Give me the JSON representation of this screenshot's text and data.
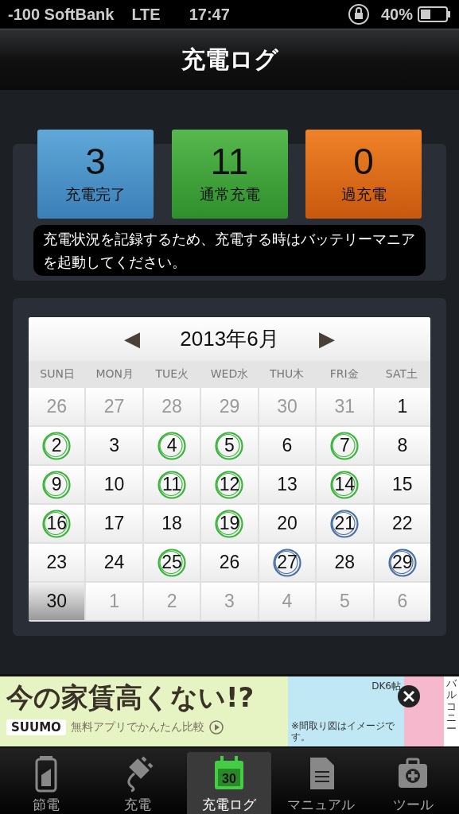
{
  "status_bar": {
    "carrier": "-100 SoftBank",
    "network": "LTE",
    "time": "17:47",
    "battery": "40%"
  },
  "header": {
    "title": "充電ログ"
  },
  "summary": [
    {
      "kind": "complete",
      "count": "3",
      "label": "充電完了"
    },
    {
      "kind": "normal",
      "count": "11",
      "label": "通常充電"
    },
    {
      "kind": "over",
      "count": "0",
      "label": "過充電"
    }
  ],
  "notice": "充電状況を記録するため、充電する時はバッテリーマニアを起動してください。",
  "calendar": {
    "prev": "◀",
    "title": "2013年6月",
    "next": "▶",
    "weekdays": [
      "SUN日",
      "MON月",
      "TUE火",
      "WED水",
      "THU木",
      "FRI金",
      "SAT土"
    ],
    "days": [
      {
        "day": "26",
        "muted": true,
        "selected": false
      },
      {
        "day": "27",
        "muted": true,
        "selected": false
      },
      {
        "day": "28",
        "muted": true,
        "selected": false
      },
      {
        "day": "29",
        "muted": true,
        "selected": false
      },
      {
        "day": "30",
        "muted": true,
        "selected": false
      },
      {
        "day": "31",
        "muted": true,
        "selected": false
      },
      {
        "day": "1",
        "muted": false,
        "selected": false
      },
      {
        "day": "2",
        "muted": false,
        "selected": false,
        "color": "#3cb43c"
      },
      {
        "day": "3",
        "muted": false,
        "selected": false
      },
      {
        "day": "4",
        "muted": false,
        "selected": false,
        "color": "#3cb43c"
      },
      {
        "day": "5",
        "muted": false,
        "selected": false,
        "color": "#3cb43c"
      },
      {
        "day": "6",
        "muted": false,
        "selected": false
      },
      {
        "day": "7",
        "muted": false,
        "selected": false,
        "color": "#3cb43c"
      },
      {
        "day": "8",
        "muted": false,
        "selected": false
      },
      {
        "day": "9",
        "muted": false,
        "selected": false,
        "color": "#3cb43c"
      },
      {
        "day": "10",
        "muted": false,
        "selected": false
      },
      {
        "day": "11",
        "muted": false,
        "selected": false,
        "color": "#3cb43c"
      },
      {
        "day": "12",
        "muted": false,
        "selected": false,
        "color": "#3cb43c"
      },
      {
        "day": "13",
        "muted": false,
        "selected": false
      },
      {
        "day": "14",
        "muted": false,
        "selected": false,
        "color": "#3cb43c"
      },
      {
        "day": "15",
        "muted": false,
        "selected": false
      },
      {
        "day": "16",
        "muted": false,
        "selected": false,
        "color": "#3cb43c"
      },
      {
        "day": "17",
        "muted": false,
        "selected": false
      },
      {
        "day": "18",
        "muted": false,
        "selected": false
      },
      {
        "day": "19",
        "muted": false,
        "selected": false,
        "color": "#3cb43c"
      },
      {
        "day": "20",
        "muted": false,
        "selected": false
      },
      {
        "day": "21",
        "muted": false,
        "selected": false,
        "color": "#4a70a0"
      },
      {
        "day": "22",
        "muted": false,
        "selected": false
      },
      {
        "day": "23",
        "muted": false,
        "selected": false
      },
      {
        "day": "24",
        "muted": false,
        "selected": false
      },
      {
        "day": "25",
        "muted": false,
        "selected": false,
        "color": "#3cb43c"
      },
      {
        "day": "26",
        "muted": false,
        "selected": false
      },
      {
        "day": "27",
        "muted": false,
        "selected": false,
        "color": "#4a70a0"
      },
      {
        "day": "28",
        "muted": false,
        "selected": false
      },
      {
        "day": "29",
        "muted": false,
        "selected": false,
        "color": "#4a70a0"
      },
      {
        "day": "30",
        "muted": false,
        "selected": true
      },
      {
        "day": "1",
        "muted": true,
        "selected": false
      },
      {
        "day": "2",
        "muted": true,
        "selected": false
      },
      {
        "day": "3",
        "muted": true,
        "selected": false
      },
      {
        "day": "4",
        "muted": true,
        "selected": false
      },
      {
        "day": "5",
        "muted": true,
        "selected": false
      },
      {
        "day": "6",
        "muted": true,
        "selected": false
      }
    ]
  },
  "ad": {
    "headline": "今の家賃高くない!?",
    "brand": "SUUMO",
    "tagline": "無料アプリでかんたん比較",
    "room": "DK6帖",
    "balcony": "バルコニー",
    "note": "※間取り図はイメージです。"
  },
  "tabs": [
    {
      "kind": "battery",
      "label": "節電",
      "selected": false
    },
    {
      "kind": "plug",
      "label": "充電",
      "selected": false
    },
    {
      "kind": "calendar",
      "label": "充電ログ",
      "selected": true,
      "badge": "30"
    },
    {
      "kind": "document",
      "label": "マニュアル",
      "selected": false
    },
    {
      "kind": "toolbox",
      "label": "ツール",
      "selected": false
    }
  ]
}
